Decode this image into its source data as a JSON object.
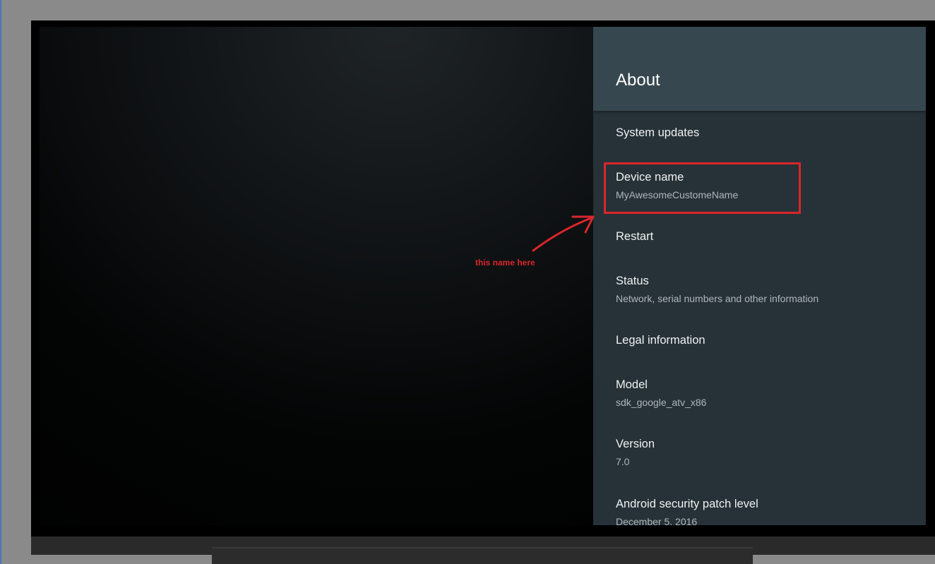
{
  "settings": {
    "title": "About",
    "items": [
      {
        "title": "System updates",
        "subtitle": ""
      },
      {
        "title": "Device name",
        "subtitle": "MyAwesomeCustomeName"
      },
      {
        "title": "Restart",
        "subtitle": ""
      },
      {
        "title": "Status",
        "subtitle": "Network, serial numbers and other information"
      },
      {
        "title": "Legal information",
        "subtitle": ""
      },
      {
        "title": "Model",
        "subtitle": "sdk_google_atv_x86"
      },
      {
        "title": "Version",
        "subtitle": "7.0"
      },
      {
        "title": "Android security patch level",
        "subtitle": "December 5, 2016"
      }
    ]
  },
  "annotation": {
    "text": "this name here",
    "color": "#d9262c"
  },
  "colors": {
    "panel_bg": "#263238",
    "header_bg": "#37474f"
  }
}
